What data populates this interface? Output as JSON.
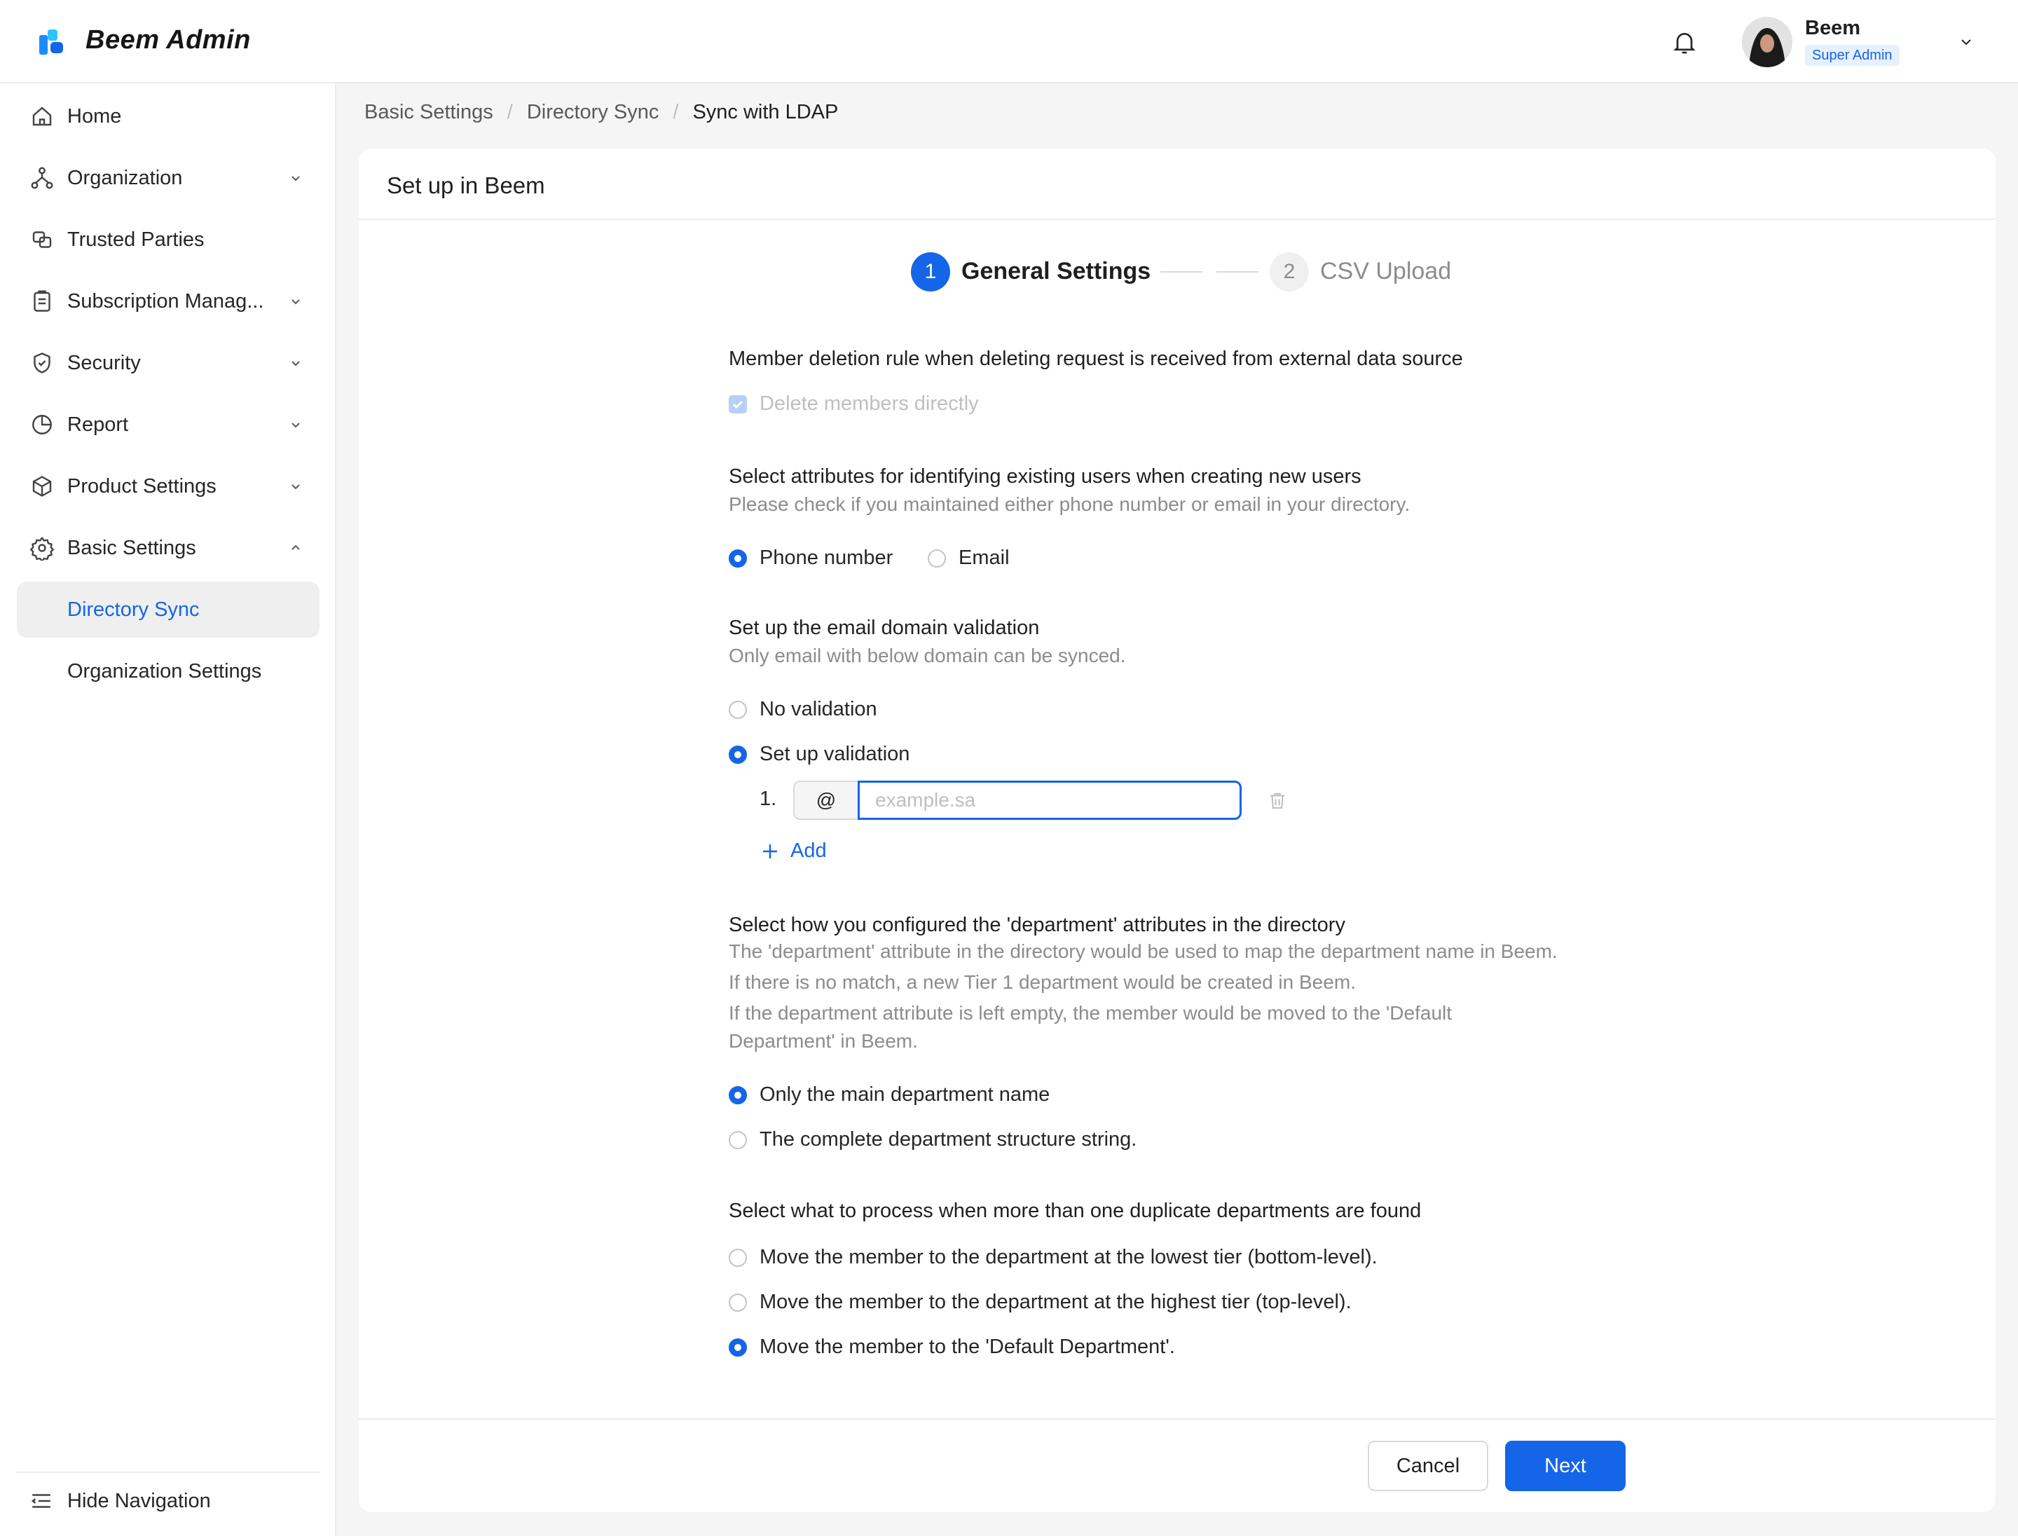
{
  "app": {
    "title": "Beem Admin"
  },
  "user": {
    "name": "Beem",
    "role": "Super Admin"
  },
  "sidebar": {
    "items": [
      {
        "label": "Home",
        "icon": "home-icon"
      },
      {
        "label": "Organization",
        "icon": "org-chart-icon"
      },
      {
        "label": "Trusted Parties",
        "icon": "handshake-icon"
      },
      {
        "label": "Subscription Manag...",
        "icon": "clipboard-icon"
      },
      {
        "label": "Security",
        "icon": "shield-icon"
      },
      {
        "label": "Report",
        "icon": "pie-chart-icon"
      },
      {
        "label": "Product Settings",
        "icon": "box-icon"
      },
      {
        "label": "Basic Settings",
        "icon": "gear-icon"
      }
    ],
    "sub_items": [
      {
        "label": "Directory Sync",
        "active": true
      },
      {
        "label": "Organization Settings",
        "active": false
      }
    ],
    "hide_nav_label": "Hide Navigation"
  },
  "breadcrumb": [
    "Basic Settings",
    "Directory Sync",
    "Sync with LDAP"
  ],
  "card": {
    "title": "Set up in Beem"
  },
  "steps": [
    {
      "number": "1",
      "label": "General Settings",
      "state": "active"
    },
    {
      "number": "2",
      "label": "CSV Upload",
      "state": "pending"
    }
  ],
  "sections": {
    "deletion": {
      "title": "Member deletion rule when deleting request is received from external data source",
      "option": "Delete members directly"
    },
    "identify": {
      "title": "Select attributes for identifying existing users when creating new users",
      "desc": "Please check if you maintained either phone number or email in your directory.",
      "options": [
        "Phone number",
        "Email"
      ],
      "selected": "Phone number"
    },
    "email_domain": {
      "title": "Set up the email domain validation",
      "desc": "Only email with below domain can be synced.",
      "options": [
        "No validation",
        "Set up validation"
      ],
      "selected": "Set up validation",
      "row_number": "1.",
      "at": "@",
      "placeholder": "example.sa",
      "value": "",
      "add_label": "Add"
    },
    "department": {
      "title": "Select how you configured the 'department' attributes in the directory",
      "desc_lines": [
        "The 'department' attribute in the directory would be used to map the department name in Beem.",
        "If there is no match, a new Tier 1 department would be created in Beem.",
        "If the department attribute is left empty, the member would be moved to the 'Default",
        "Department' in Beem."
      ],
      "options": [
        "Only the main department name",
        "The complete department structure string."
      ],
      "selected": "Only the main department name"
    },
    "duplicate": {
      "title": "Select what to process when more than one duplicate departments are found",
      "options": [
        "Move the member to the department at the lowest tier (bottom-level).",
        "Move the member to the department at the highest tier (top-level).",
        "Move the member to the 'Default Department'."
      ],
      "selected": "Move the member to the 'Default Department'."
    }
  },
  "buttons": {
    "cancel": "Cancel",
    "next": "Next"
  },
  "colors": {
    "accent": "#1565e8",
    "muted_text": "#8c8c8c"
  }
}
